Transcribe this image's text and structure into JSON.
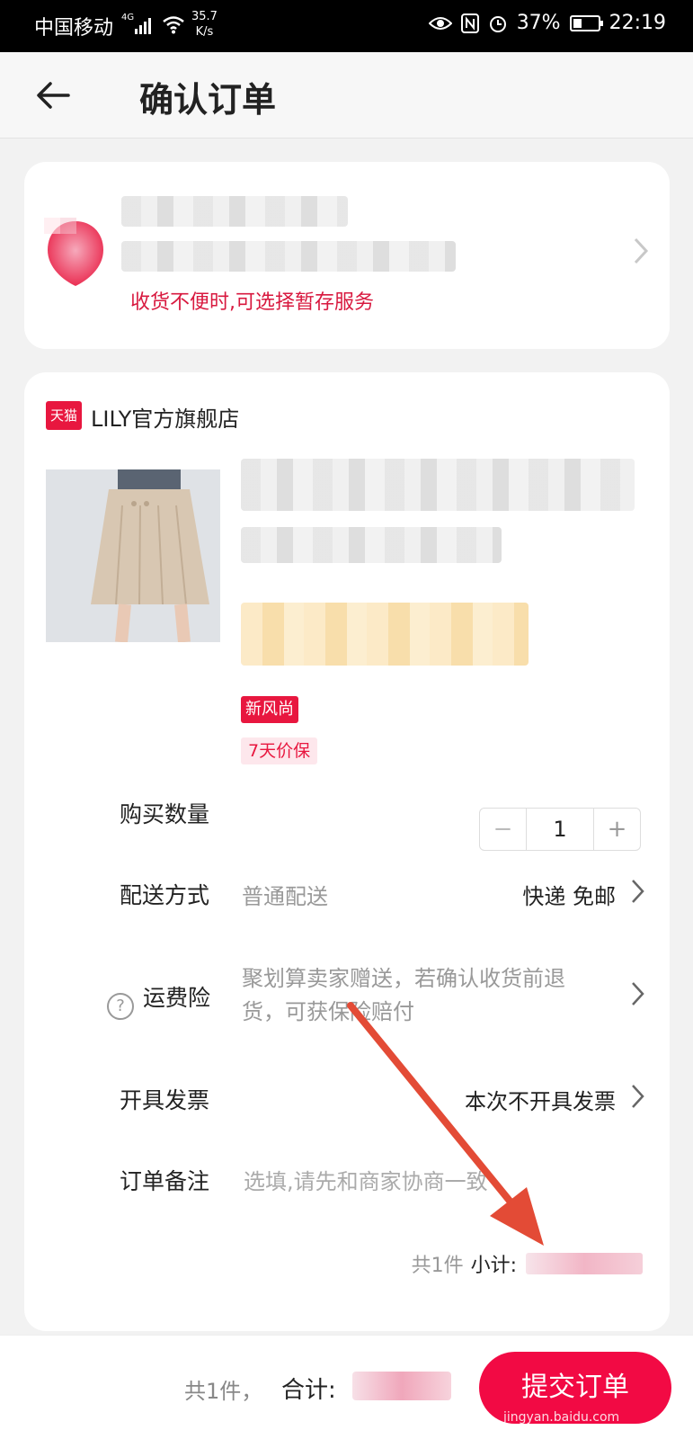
{
  "status_bar": {
    "carrier": "中国移动",
    "signal_type": "4G",
    "net_speed": "35.7",
    "net_speed_unit": "K/s",
    "battery": "37%",
    "time": "22:19"
  },
  "header": {
    "title": "确认订单"
  },
  "address": {
    "hint": "收货不便时,可选择暂存服务"
  },
  "shop": {
    "logo_text": "天猫",
    "name": "LILY官方旗舰店"
  },
  "product": {
    "badge_new": "新风尚",
    "badge_price": "7天价保"
  },
  "rows": {
    "quantity_label": "购买数量",
    "quantity": "1",
    "minus": "−",
    "plus": "+",
    "delivery_label": "配送方式",
    "delivery_sub": "普通配送",
    "delivery_value": "快递 免邮",
    "insurance_label": "运费险",
    "insurance_sub": "聚划算卖家赠送，若确认收货前退货，可获保险赔付",
    "invoice_label": "开具发票",
    "invoice_value": "本次不开具发票",
    "note_label": "订单备注",
    "note_placeholder": "选填,请先和商家协商一致"
  },
  "subtotal": {
    "count": "共1件",
    "label": "小计:"
  },
  "bottom": {
    "count": "共1件，",
    "total_label": "合计:",
    "submit": "提交订单"
  },
  "watermark": "jingyan.baidu.com",
  "colors": {
    "accent": "#f20a44",
    "hint": "#d8193f",
    "arrow": "#e34b36"
  }
}
